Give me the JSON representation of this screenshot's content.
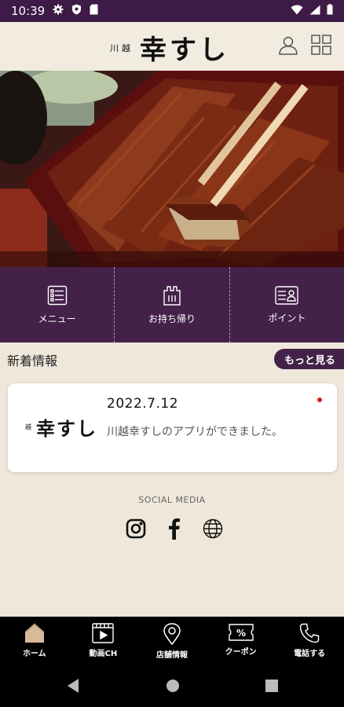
{
  "status_bar": {
    "time": "10:39",
    "left_icons": [
      "gear-icon",
      "shield-icon",
      "sd-card-icon"
    ],
    "right_icons": [
      "wifi-icon",
      "signal-icon",
      "battery-icon"
    ]
  },
  "header": {
    "logo_small": "川越",
    "logo_main": "幸すし"
  },
  "hero": {
    "image": "unagi-jubako-photo"
  },
  "quick_menu": [
    {
      "label": "メニュー",
      "icon": "menu-list-icon"
    },
    {
      "label": "お持ち帰り",
      "icon": "takeout-bag-icon"
    },
    {
      "label": "ポイント",
      "icon": "point-card-icon"
    }
  ],
  "news": {
    "title": "新着情報",
    "more_label": "もっと見る",
    "items": [
      {
        "date": "2022.7.12",
        "text": "川越幸すしのアプリができました。",
        "logo_small": "越",
        "logo_main": "幸すし"
      }
    ]
  },
  "social": {
    "label": "SOCIAL MEDIA",
    "icons": [
      "instagram-icon",
      "facebook-icon",
      "website-globe-icon"
    ]
  },
  "bottom_nav": [
    {
      "label": "ホーム",
      "icon": "home-icon",
      "active": true
    },
    {
      "label": "動画CH",
      "icon": "video-icon",
      "active": false
    },
    {
      "label": "店舗情報",
      "icon": "location-pin-icon",
      "active": false
    },
    {
      "label": "クーポン",
      "icon": "coupon-icon",
      "active": false
    },
    {
      "label": "電話する",
      "icon": "phone-icon",
      "active": false
    }
  ],
  "colors": {
    "primary": "#432149",
    "status_bar": "#3d1b46",
    "background": "#efe7da",
    "unread_dot": "#e01818"
  }
}
